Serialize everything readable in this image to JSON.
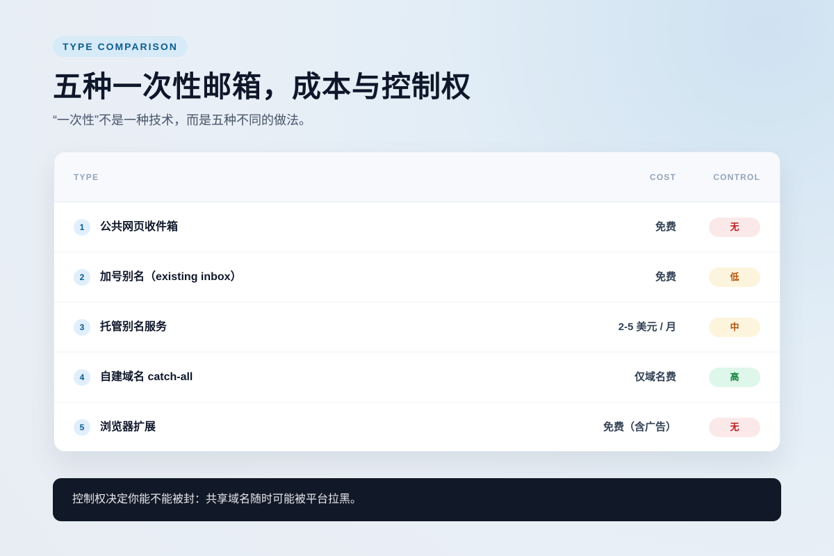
{
  "header": {
    "kicker": "TYPE COMPARISON",
    "title": "五种一次性邮箱，成本与控制权",
    "subtitle": "“一次性”不是一种技术，而是五种不同的做法。"
  },
  "table": {
    "columns": {
      "type": "TYPE",
      "cost": "COST",
      "control": "CONTROL"
    },
    "rows": [
      {
        "num": "1",
        "name": "公共网页收件箱",
        "cost": "免费",
        "control": "无",
        "control_bg": "#fbe9ea",
        "control_fg": "#b91c1c"
      },
      {
        "num": "2",
        "name": "加号别名（existing inbox）",
        "cost": "免费",
        "control": "低",
        "control_bg": "#fdf4de",
        "control_fg": "#b45309"
      },
      {
        "num": "3",
        "name": "托管别名服务",
        "cost": "2-5 美元 / 月",
        "control": "中",
        "control_bg": "#fdf4de",
        "control_fg": "#b45309"
      },
      {
        "num": "4",
        "name": "自建域名 catch-all",
        "cost": "仅域名费",
        "control": "高",
        "control_bg": "#def7ea",
        "control_fg": "#15803d"
      },
      {
        "num": "5",
        "name": "浏览器扩展",
        "cost": "免费（含广告）",
        "control": "无",
        "control_bg": "#fbe9ea",
        "control_fg": "#b91c1c"
      }
    ]
  },
  "note": {
    "text": "控制权决定你能不能被封：共享域名随时可能被平台拉黑。"
  },
  "colors": {
    "accent": "#0b5c8e",
    "dark_banner": "#111827"
  }
}
